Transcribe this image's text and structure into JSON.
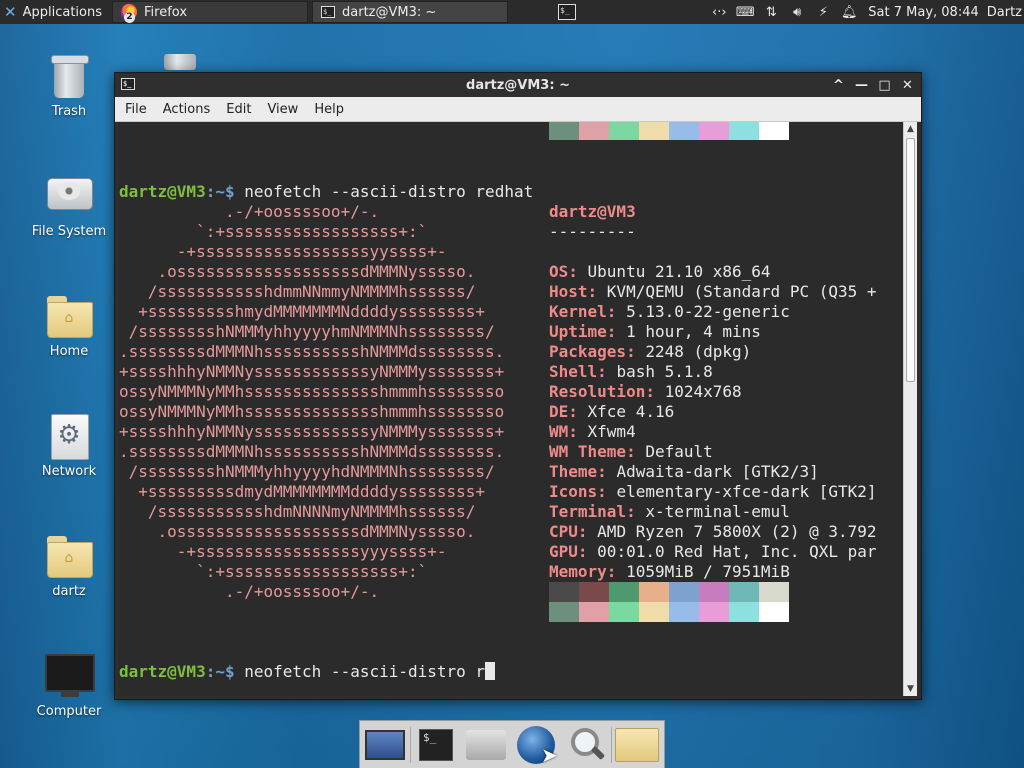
{
  "panel": {
    "apps_label": "Applications",
    "tasks": [
      {
        "label": "Firefox",
        "badge": "2"
      },
      {
        "label": "dartz@VM3: ~"
      }
    ],
    "clock": "Sat  7 May, 08:44",
    "user": "Dartz",
    "tray_icons": [
      "network-icon",
      "keyboard-icon",
      "transfer-icon",
      "volume-icon",
      "power-icon",
      "notification-icon"
    ]
  },
  "desktop_icons": [
    {
      "label": "Trash",
      "icon": "trash-icon"
    },
    {
      "label": "File System",
      "icon": "drive-icon"
    },
    {
      "label": "Home",
      "icon": "home-folder-icon"
    },
    {
      "label": "Network",
      "icon": "network-icon"
    },
    {
      "label": "dartz",
      "icon": "folder-icon"
    },
    {
      "label": "Computer",
      "icon": "monitor-icon"
    }
  ],
  "window": {
    "title": "dartz@VM3: ~",
    "menus": [
      "File",
      "Actions",
      "Edit",
      "View",
      "Help"
    ],
    "controls": [
      "^",
      "—",
      "□",
      "✕"
    ]
  },
  "terminal": {
    "prompt_user": "dartz@VM3",
    "prompt_sep": ":~$ ",
    "command_1": "neofetch --ascii-distro redhat",
    "command_2": "neofetch --ascii-distro r",
    "ascii_art": [
      "           .-/+oossssoo+/-.",
      "        `:+ssssssssssssssssss+:`",
      "      -+ssssssssssssssssssyyssss+-",
      "    .osssssssssssssssssssdMMMNysssso.",
      "   /ssssssssssshdmmNNmmyNMMMMhssssss/",
      "  +ssssssssshmydMMMMMMMNddddyssssssss+",
      " /sssssssshNMMMyhhyyyyhmNMMMNhssssssss/",
      ".ssssssssdMMMNhsssssssssshNMMMdssssssss.",
      "+sssshhhyNMMNyssssssssssssyNMMMysssssss+",
      "ossyNMMMNyMMhsssssssssssssshmmmhssssssso",
      "ossyNMMMNyMMhsssssssssssssshmmmhssssssso",
      "+sssshhhyNMMNyssssssssssssyNMMMysssssss+",
      ".ssssssssdMMMNhsssssssssshNMMMdssssssss.",
      " /sssssssshNMMMyhhyyyyhdNMMMNhssssssss/",
      "  +sssssssssdmydMMMMMMMMddddyssssssss+",
      "   /ssssssssssshdmNNNNmyNMMMMhssssss/",
      "    .osssssssssssssssssssdMMMNysssso.",
      "      -+sssssssssssssssssyyyssss+-",
      "        `:+ssssssssssssssssss+:`",
      "           .-/+oossssoo+/-."
    ],
    "info_title": "dartz@VM3",
    "info_rule": "---------",
    "info": [
      {
        "key": "OS",
        "value": "Ubuntu 21.10 x86_64"
      },
      {
        "key": "Host",
        "value": "KVM/QEMU (Standard PC (Q35 +"
      },
      {
        "key": "Kernel",
        "value": "5.13.0-22-generic"
      },
      {
        "key": "Uptime",
        "value": "1 hour, 4 mins"
      },
      {
        "key": "Packages",
        "value": "2248 (dpkg)"
      },
      {
        "key": "Shell",
        "value": "bash 5.1.8"
      },
      {
        "key": "Resolution",
        "value": "1024x768"
      },
      {
        "key": "DE",
        "value": "Xfce 4.16"
      },
      {
        "key": "WM",
        "value": "Xfwm4"
      },
      {
        "key": "WM Theme",
        "value": "Default"
      },
      {
        "key": "Theme",
        "value": "Adwaita-dark [GTK2/3]"
      },
      {
        "key": "Icons",
        "value": "elementary-xfce-dark [GTK2]"
      },
      {
        "key": "Terminal",
        "value": "x-terminal-emul"
      },
      {
        "key": "CPU",
        "value": "AMD Ryzen 7 5800X (2) @ 3.792"
      },
      {
        "key": "GPU",
        "value": "00:01.0 Red Hat, Inc. QXL par"
      },
      {
        "key": "Memory",
        "value": "1059MiB / 7951MiB"
      }
    ],
    "palette_dark": [
      "#4a4a4a",
      "#7a4a4a",
      "#4e9a6e",
      "#e8b08a",
      "#7ea2d0",
      "#c87cc0",
      "#6fb8b8",
      "#d8d8cc"
    ],
    "palette_bright": [
      "#6e8e7e",
      "#e0a0a8",
      "#7ad8a0",
      "#f0dca8",
      "#98bce8",
      "#e89cd8",
      "#8ce0e0",
      "#ffffff"
    ]
  },
  "dock": {
    "items": [
      "show-desktop-icon",
      "terminal-icon",
      "home-icon",
      "web-browser-icon",
      "search-icon",
      "folder-icon"
    ]
  }
}
